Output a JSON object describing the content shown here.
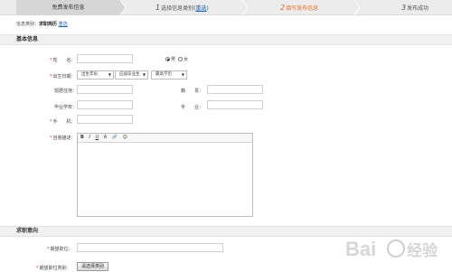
{
  "steps": {
    "step1": "免费发布信息",
    "step2_num": "1",
    "step2_text": "选择信息类别(",
    "step2_link": "重选",
    "step2_end": ")",
    "step3_num": "2",
    "step3_text": "填写发布信息",
    "step4_num": "3",
    "step4_text": "发布成功",
    "active_color": "#e8722c"
  },
  "category": {
    "prefix": "信息类别：",
    "value": "求职简历",
    "reselect": "重选"
  },
  "basic": {
    "title": "基本信息",
    "name_label": "姓　　名：",
    "gender_male": "男",
    "gender_female": "女",
    "birth_label": "出生日期：",
    "birth_year": "出生年份",
    "graduate_year": "应届毕业生",
    "education": "最高学历",
    "current_label": "现居住地：",
    "native_label": "籍　　贯：",
    "school_label": "毕业学校：",
    "major_label": "专　　业：",
    "phone_label": "手　　机：",
    "intro_label": "自我描述："
  },
  "editor": {
    "tools": [
      "B",
      "I",
      "U",
      "A",
      "🔗",
      "☺"
    ]
  },
  "intent": {
    "title": "求职意向",
    "position_label": "期望职位：",
    "category_label": "期望职位类别：",
    "category_button": "请选择类别"
  },
  "watermark": {
    "text": "Bai",
    "sub": "经验"
  }
}
